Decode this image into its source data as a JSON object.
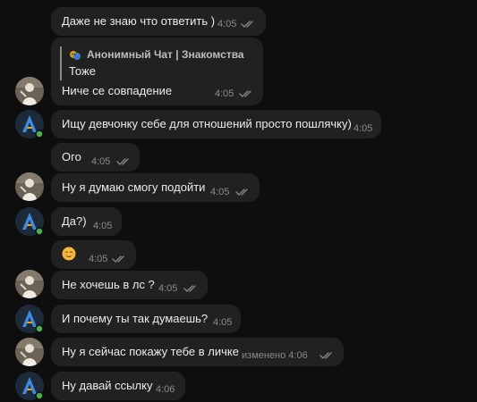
{
  "messages": [
    {
      "text": "Даже не знаю что ответить )",
      "time": "4:05"
    },
    {
      "quote_author": "Анонимный Чат | Знакомства",
      "quote_text": "Тоже",
      "text": "Ниче се совпадение",
      "time": "4:05"
    },
    {
      "text": "Ищу девчонку себе для отношений просто пошлячку)",
      "time": "4:05"
    },
    {
      "text": "Ого",
      "time": "4:05"
    },
    {
      "text": "Ну я думаю смогу подойти",
      "time": "4:05"
    },
    {
      "text": "Да?)",
      "time": "4:05"
    },
    {
      "emoji": "relieved-face",
      "time": "4:05"
    },
    {
      "text": "Не хочешь в лс ?",
      "time": "4:05"
    },
    {
      "text": "И почему ты так думаешь?",
      "time": "4:05"
    },
    {
      "text": "Ну я сейчас покажу тебе в личке",
      "time": "изменено 4:06"
    },
    {
      "text": "Ну давай ссылку",
      "time": "4:06"
    }
  ],
  "avatars": {
    "user": "person-photo-avatar",
    "bot": "blue-a-logo-avatar"
  },
  "colors": {
    "background": "#0e0e0e",
    "bubble": "#212121",
    "text": "#ececec",
    "time": "#8a8a8a",
    "online": "#4caf50"
  }
}
